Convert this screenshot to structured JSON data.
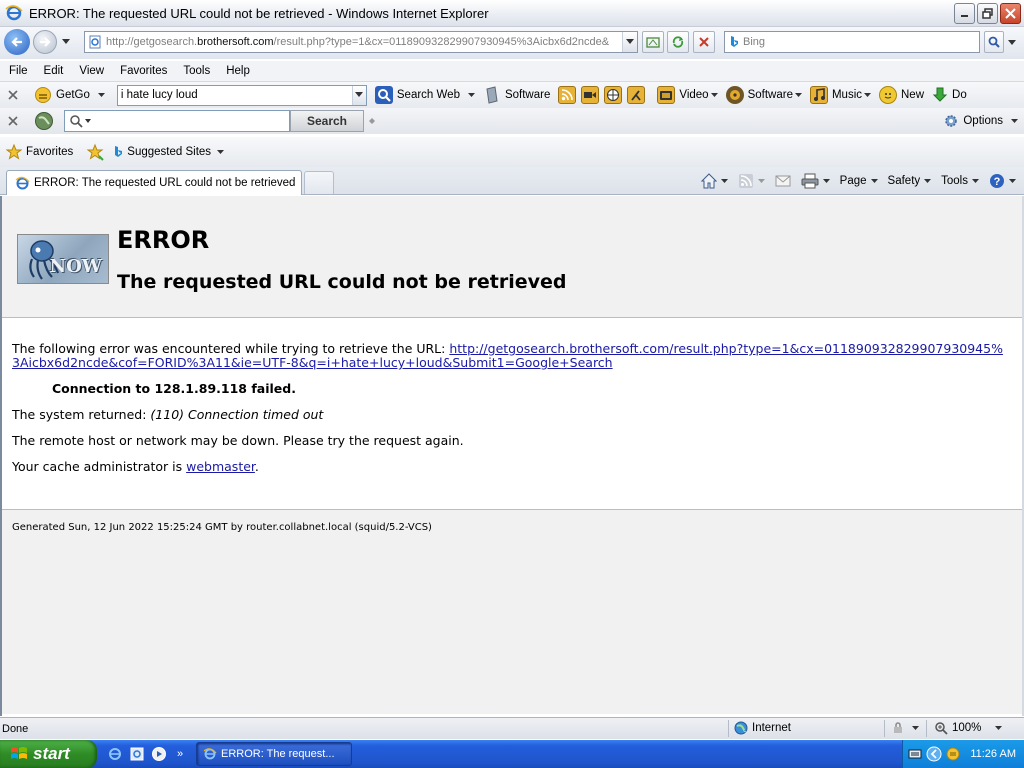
{
  "window": {
    "title": "ERROR: The requested URL could not be retrieved - Windows Internet Explorer"
  },
  "address": {
    "url_prefix": "http://getgosearch.",
    "url_domain": "brothersoft.com",
    "url_rest": "/result.php?type=1&cx=011890932829907930945%3Aicbx6d2ncde&"
  },
  "search_box": {
    "placeholder": "Bing"
  },
  "menu": {
    "items": [
      "File",
      "Edit",
      "View",
      "Favorites",
      "Tools",
      "Help"
    ]
  },
  "getgo_toolbar": {
    "brand": "GetGo",
    "query": "i hate lucy loud",
    "search_web": "Search Web",
    "software": "Software",
    "video": "Video",
    "software2": "Software",
    "music": "Music",
    "new": "New",
    "cut_label": "Do"
  },
  "toolbar2": {
    "search_button": "Search",
    "options": "Options"
  },
  "favorites_bar": {
    "favorites": "Favorites",
    "suggested": "Suggested Sites"
  },
  "tab": {
    "label": "ERROR: The requested URL could not be retrieved"
  },
  "command_bar": {
    "page": "Page",
    "safety": "Safety",
    "tools": "Tools"
  },
  "page": {
    "heading": "ERROR",
    "subheading": "The requested URL could not be retrieved",
    "logo_text": "NOW",
    "intro": "The following error was encountered while trying to retrieve the URL: ",
    "url_link_line1": "http://getgosearch.brothersoft.com/result.php?type=1&cx=011890932829907930945%",
    "url_link_line2": "3Aicbx6d2ncde&cof=FORID%3A11&ie=UTF-8&q=i+hate+lucy+loud&Submit1=Google+Search",
    "connection": "Connection to 128.1.89.118 failed.",
    "system_returned_label": "The system returned: ",
    "system_returned_value": "(110) Connection timed out",
    "remote_msg": "The remote host or network may be down. Please try the request again.",
    "admin_prefix": "Your cache administrator is ",
    "admin_link": "webmaster",
    "admin_suffix": ".",
    "footer": "Generated Sun, 12 Jun 2022 15:25:24 GMT by router.collabnet.local (squid/5.2-VCS)"
  },
  "status_bar": {
    "status": "Done",
    "zone": "Internet",
    "zoom": "100%"
  },
  "taskbar": {
    "start": "start",
    "task": "ERROR: The request...",
    "time": "11:26 AM"
  }
}
